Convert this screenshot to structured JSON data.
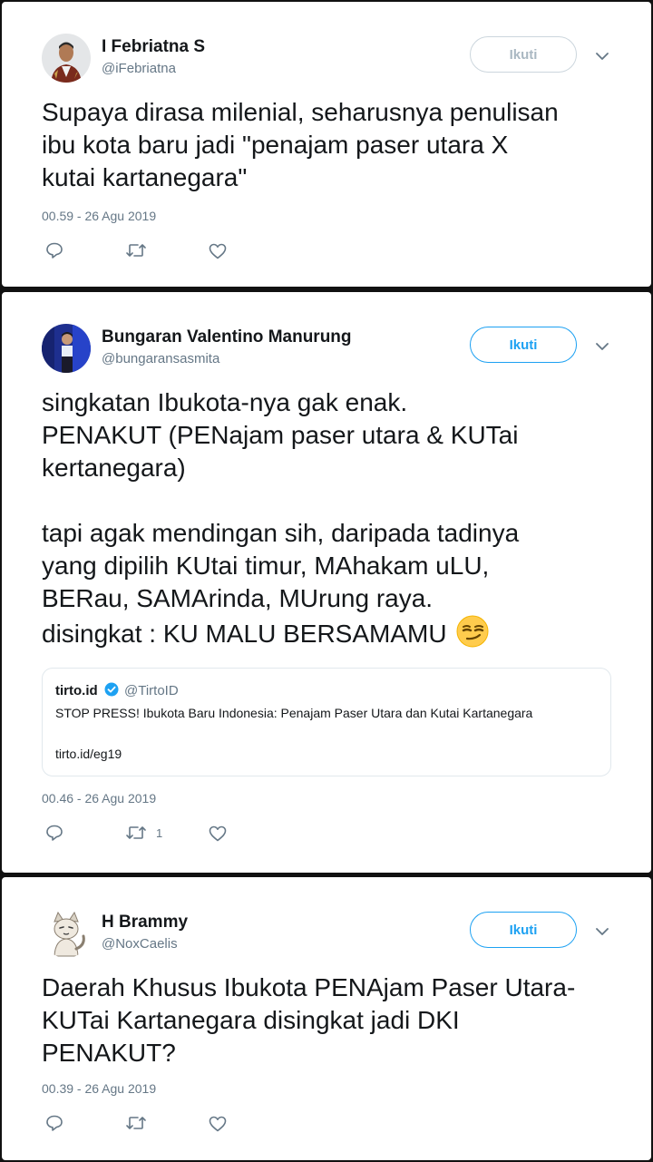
{
  "colors": {
    "accent": "#1da1f2",
    "text": "#14171a",
    "muted": "#657786",
    "disabled_button": "#aab8c2",
    "background": "#111111"
  },
  "icons": [
    "reply-icon",
    "retweet-icon",
    "like-icon",
    "chevron-down-icon",
    "verified-badge-icon",
    "smirking-face-emoji"
  ],
  "tweets": [
    {
      "name": "I Febriatna S",
      "handle": "@iFebriatna",
      "follow_label": "Ikuti",
      "follow_state": "disabled",
      "text_lines": [
        "Supaya dirasa milenial, seharusnya penulisan",
        "ibu kota baru jadi \"penajam paser utara X",
        "kutai kartanegara\""
      ],
      "time": "00.59 - 26 Agu 2019",
      "retweet_count": ""
    },
    {
      "name": "Bungaran Valentino Manurung",
      "handle": "@bungaransasmita",
      "follow_label": "Ikuti",
      "follow_state": "active",
      "text_lines": [
        "singkatan Ibukota-nya gak enak.",
        "PENAKUT (PENajam paser utara & KUTai",
        "kertanegara)",
        "",
        "tapi agak mendingan sih, daripada tadinya",
        "yang dipilih KUtai timur, MAhakam uLU,",
        "BERau, SAMArinda, MUrung raya.",
        "disingkat : KU MALU BERSAMAMU"
      ],
      "quote": {
        "name": "tirto.id",
        "handle": "@TirtoID",
        "text": "STOP PRESS! Ibukota Baru Indonesia: Penajam Paser Utara dan Kutai Kartanegara",
        "link": "tirto.id/eg19"
      },
      "time": "00.46 - 26 Agu 2019",
      "retweet_count": "1"
    },
    {
      "name": "H Brammy",
      "handle": "@NoxCaelis",
      "follow_label": "Ikuti",
      "follow_state": "active",
      "text_lines": [
        "Daerah Khusus Ibukota PENAjam Paser Utara-",
        "KUTai Kartanegara disingkat jadi DKI",
        "PENAKUT?"
      ],
      "time": "00.39 - 26 Agu 2019",
      "retweet_count": ""
    }
  ]
}
